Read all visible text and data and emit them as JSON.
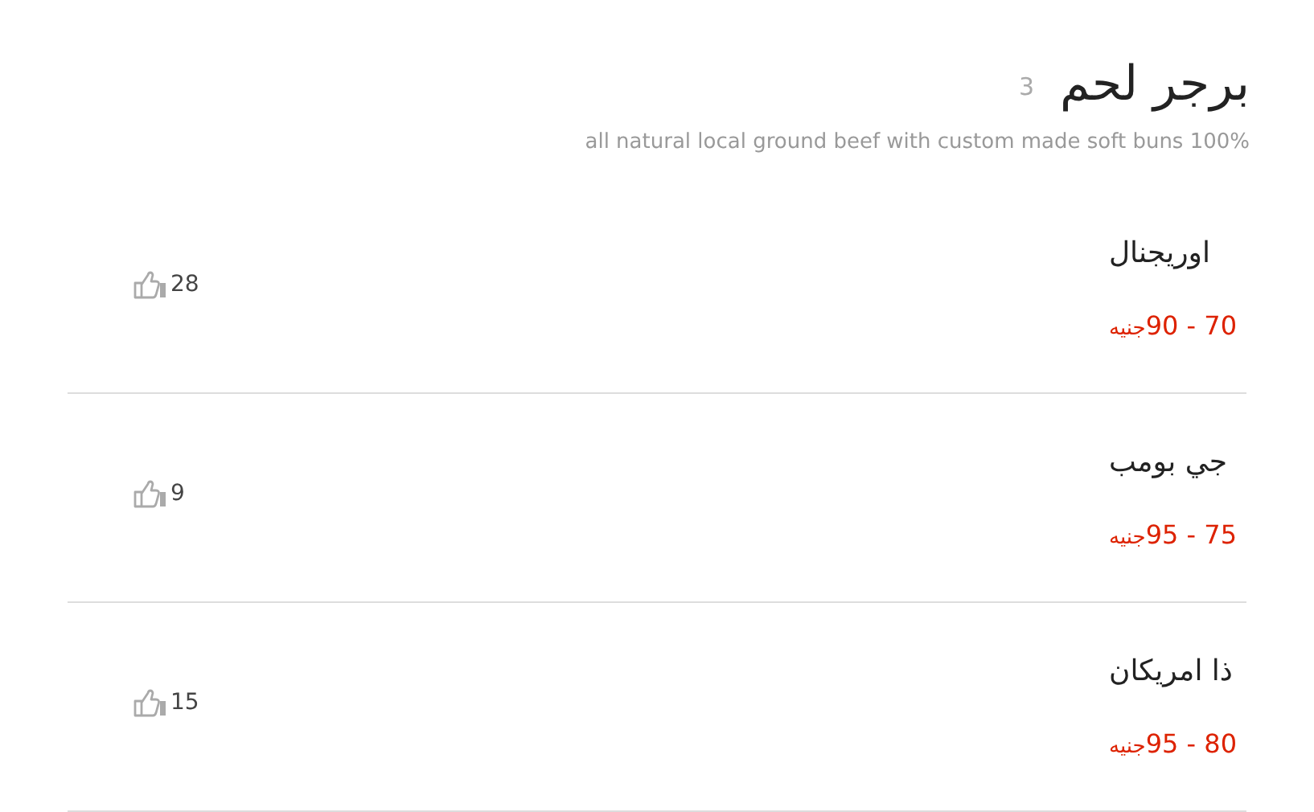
{
  "category": {
    "title": "برجر لحم",
    "count": "3",
    "description": "all natural local ground beef with custom made soft buns 100%"
  },
  "items": [
    {
      "name": "اوريجنال",
      "price_range": "70 - 90",
      "currency": "جنيه",
      "likes": "28"
    },
    {
      "name": "جي بومب",
      "price_range": "75 - 95",
      "currency": "جنيه",
      "likes": "9"
    },
    {
      "name": "ذا امريكان",
      "price_range": "80 - 95",
      "currency": "جنيه",
      "likes": "15"
    }
  ]
}
